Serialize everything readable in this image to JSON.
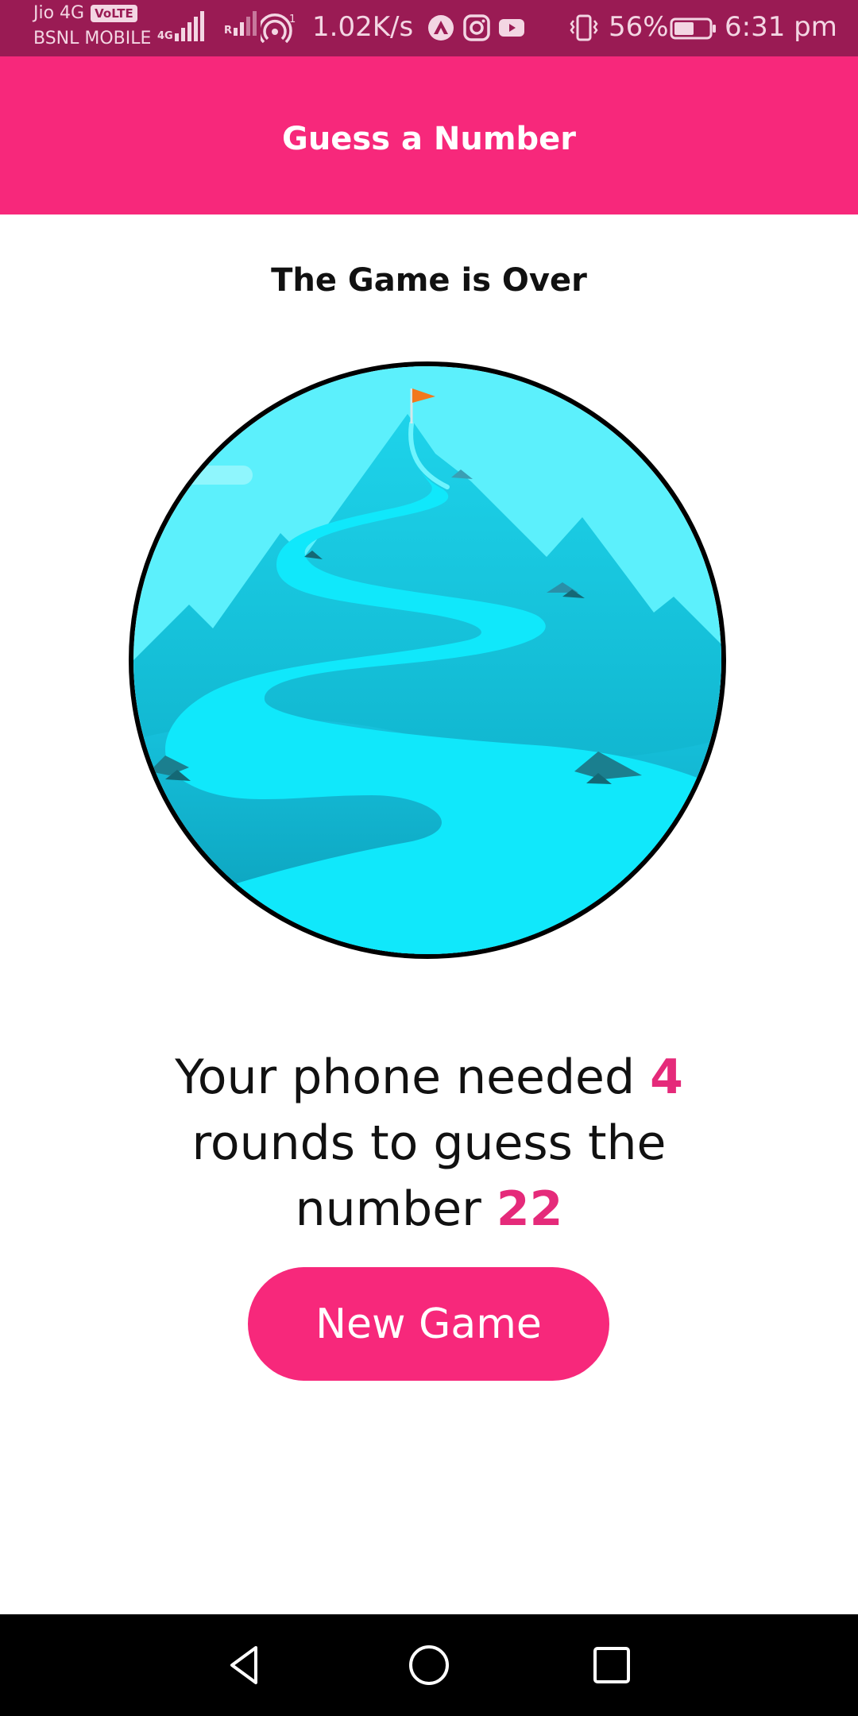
{
  "status_bar": {
    "carrier_primary": "Jio 4G",
    "volte_badge": "VoLTE",
    "carrier_secondary": "BSNL MOBILE",
    "network_tag_1": "4G",
    "network_tag_2": "R",
    "hotspot_superscript": "1",
    "speed": "1.02K/s",
    "app_icons": [
      "triangle-app-icon",
      "instagram-icon",
      "youtube-icon"
    ],
    "battery_percent": "56%",
    "battery_level": 0.56,
    "time": "6:31 pm"
  },
  "header": {
    "title": "Guess a Number",
    "background_color": "#f7287b"
  },
  "main": {
    "heading": "The Game is Over",
    "illustration": "mountain-summit-illustration",
    "result_prefix": "Your phone needed ",
    "rounds": "4",
    "result_middle": " rounds to guess the number ",
    "number": "22",
    "highlight_color": "#e52a7a",
    "new_game_label": "New Game"
  },
  "nav_bar": {
    "buttons": [
      "back-icon",
      "home-icon",
      "recents-icon"
    ]
  }
}
